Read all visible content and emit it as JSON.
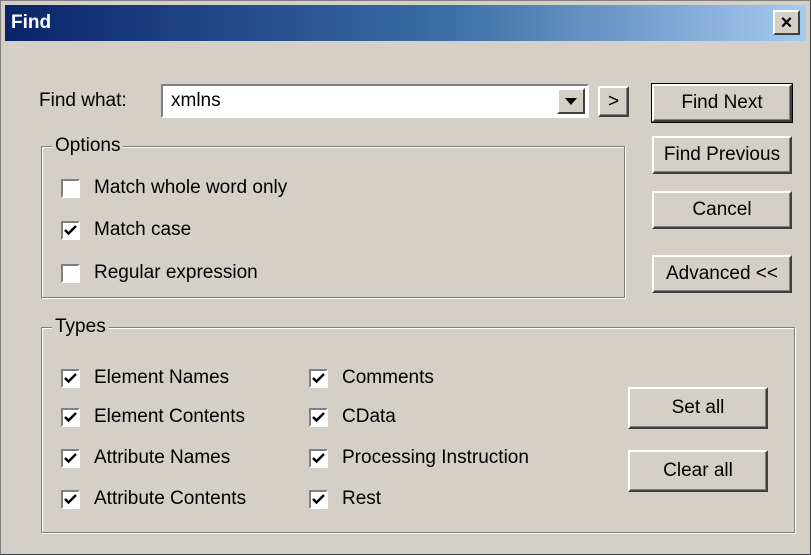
{
  "window": {
    "title": "Find",
    "close_glyph": "×"
  },
  "find_what": {
    "label": "Find what:",
    "value": "xmlns",
    "history_button": ">"
  },
  "buttons": {
    "find_next": "Find Next",
    "find_previous": "Find Previous",
    "cancel": "Cancel",
    "advanced": "Advanced <<",
    "set_all": "Set all",
    "clear_all": "Clear all"
  },
  "options": {
    "title": "Options",
    "items": [
      {
        "label": "Match whole word only",
        "checked": false
      },
      {
        "label": "Match case",
        "checked": true
      },
      {
        "label": "Regular expression",
        "checked": false
      }
    ]
  },
  "types": {
    "title": "Types",
    "left": [
      {
        "label": "Element Names",
        "checked": true
      },
      {
        "label": "Element Contents",
        "checked": true
      },
      {
        "label": "Attribute Names",
        "checked": true
      },
      {
        "label": "Attribute Contents",
        "checked": true
      }
    ],
    "right": [
      {
        "label": "Comments",
        "checked": true
      },
      {
        "label": "CData",
        "checked": true
      },
      {
        "label": "Processing Instruction",
        "checked": true
      },
      {
        "label": "Rest",
        "checked": true
      }
    ]
  },
  "colors": {
    "dialog_bg": "#d4d0c8",
    "title_start": "#0a246a",
    "title_end": "#a6caf0"
  }
}
